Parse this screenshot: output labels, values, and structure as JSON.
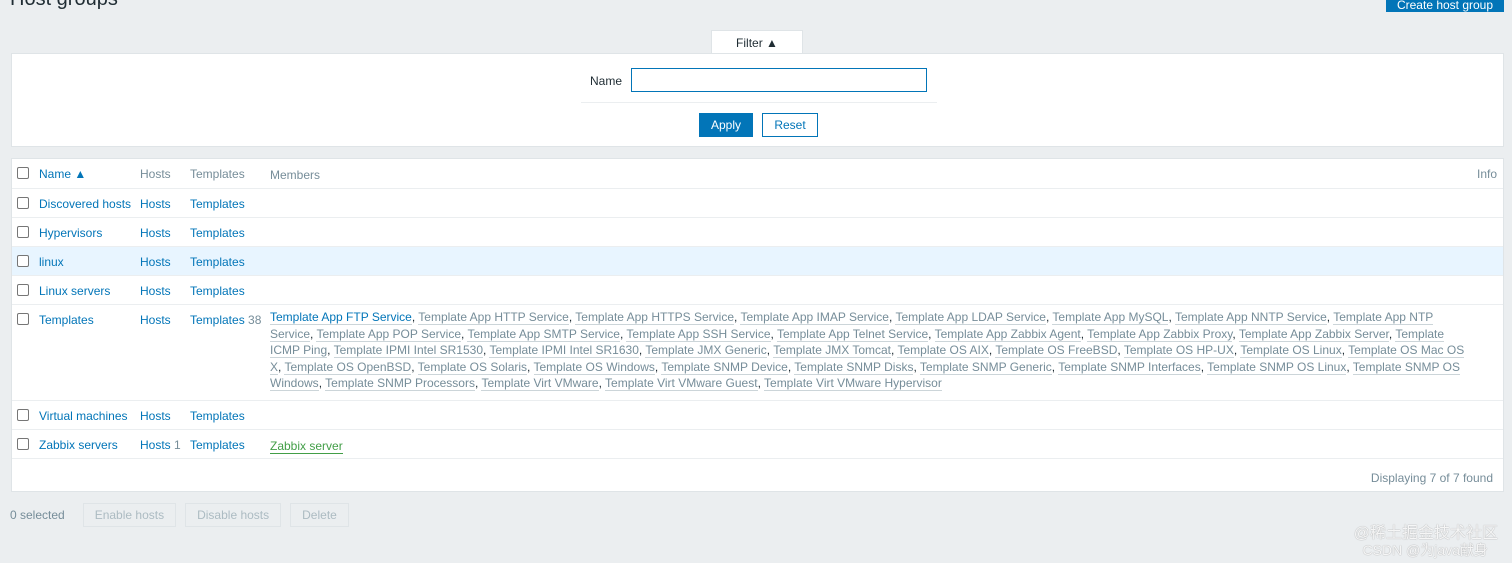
{
  "header": {
    "title": "Host groups",
    "create_button": "Create host group"
  },
  "filter": {
    "tab_label": "Filter ▲",
    "name_label": "Name",
    "name_value": "",
    "apply": "Apply",
    "reset": "Reset"
  },
  "table": {
    "columns": {
      "name": "Name ▲",
      "hosts": "Hosts",
      "templates": "Templates",
      "members": "Members",
      "info": "Info"
    },
    "rows": [
      {
        "name": "Discovered hosts",
        "hosts": "Hosts",
        "hosts_count": "",
        "templates": "Templates",
        "templates_count": "",
        "members": []
      },
      {
        "name": "Hypervisors",
        "hosts": "Hosts",
        "hosts_count": "",
        "templates": "Templates",
        "templates_count": "",
        "members": []
      },
      {
        "name": "linux",
        "hosts": "Hosts",
        "hosts_count": "",
        "templates": "Templates",
        "templates_count": "",
        "members": [],
        "highlighted": true
      },
      {
        "name": "Linux servers",
        "hosts": "Hosts",
        "hosts_count": "",
        "templates": "Templates",
        "templates_count": "",
        "members": []
      },
      {
        "name": "Templates",
        "hosts": "Hosts",
        "hosts_count": "",
        "templates": "Templates",
        "templates_count": "38",
        "members": [
          "Template App FTP Service",
          "Template App HTTP Service",
          "Template App HTTPS Service",
          "Template App IMAP Service",
          "Template App LDAP Service",
          "Template App MySQL",
          "Template App NNTP Service",
          "Template App NTP Service",
          "Template App POP Service",
          "Template App SMTP Service",
          "Template App SSH Service",
          "Template App Telnet Service",
          "Template App Zabbix Agent",
          "Template App Zabbix Proxy",
          "Template App Zabbix Server",
          "Template ICMP Ping",
          "Template IPMI Intel SR1530",
          "Template IPMI Intel SR1630",
          "Template JMX Generic",
          "Template JMX Tomcat",
          "Template OS AIX",
          "Template OS FreeBSD",
          "Template OS HP-UX",
          "Template OS Linux",
          "Template OS Mac OS X",
          "Template OS OpenBSD",
          "Template OS Solaris",
          "Template OS Windows",
          "Template SNMP Device",
          "Template SNMP Disks",
          "Template SNMP Generic",
          "Template SNMP Interfaces",
          "Template SNMP OS Linux",
          "Template SNMP OS Windows",
          "Template SNMP Processors",
          "Template Virt VMware",
          "Template Virt VMware Guest",
          "Template Virt VMware Hypervisor"
        ]
      },
      {
        "name": "Virtual machines",
        "hosts": "Hosts",
        "hosts_count": "",
        "templates": "Templates",
        "templates_count": "",
        "members": []
      },
      {
        "name": "Zabbix servers",
        "hosts": "Hosts",
        "hosts_count": "1",
        "templates": "Templates",
        "templates_count": "",
        "members": [
          "Zabbix server"
        ],
        "members_green": true
      }
    ],
    "footer": "Displaying 7 of 7 found"
  },
  "actions": {
    "selected": "0 selected",
    "enable": "Enable hosts",
    "disable": "Disable hosts",
    "delete": "Delete"
  },
  "watermark": {
    "line1": "@稀土掘金技术社区",
    "line2": "CSDN @为java献身"
  },
  "colors": {
    "accent": "#0275b8",
    "green": "#429e47",
    "row_highlight": "#e8f5ff"
  }
}
